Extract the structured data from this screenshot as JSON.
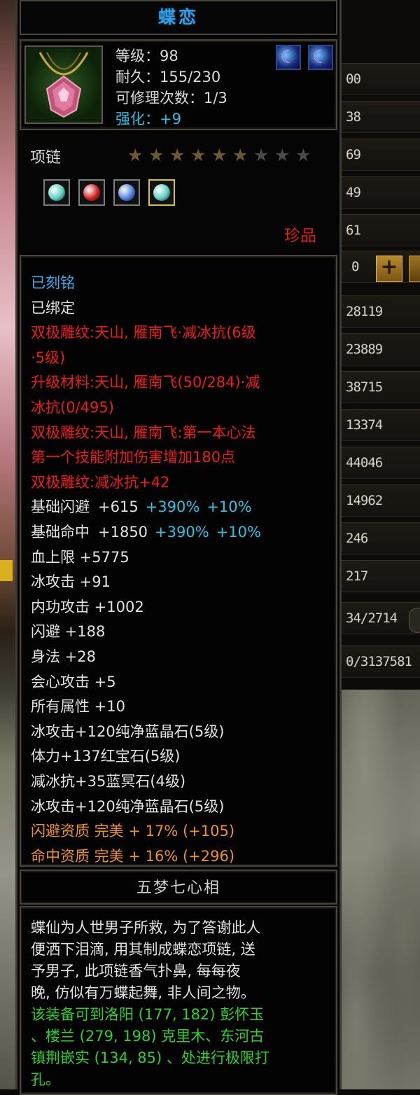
{
  "item": {
    "name": "蝶恋",
    "level": "等级：98",
    "durability": "耐久：155/230",
    "repair": "可修理次数：1/3",
    "enhance": "强化：+9",
    "type": "项链",
    "stars_total": 9,
    "stars_filled": 6,
    "rarity": "珍品"
  },
  "gems": [
    {
      "name": "cyan-gem",
      "color": "#5ad0c0"
    },
    {
      "name": "red-gem",
      "color": "#d22020"
    },
    {
      "name": "blue-gem",
      "color": "#5080e0"
    },
    {
      "name": "cyan-gem",
      "color": "#5ad0c0"
    }
  ],
  "attributes": [
    {
      "text": "已刻铭",
      "color": "blue"
    },
    {
      "text": "已绑定",
      "color": "white"
    },
    {
      "text": "双极雕纹:天山, 雁南飞·减冰抗(6级",
      "color": "red"
    },
    {
      "text": "·5级)",
      "color": "red"
    },
    {
      "text": "升级材料:天山, 雁南飞(50/284)·减",
      "color": "red"
    },
    {
      "text": "冰抗(0/495)",
      "color": "red"
    },
    {
      "text": "双极雕纹:天山, 雁南飞:第一本心法",
      "color": "red"
    },
    {
      "text": "第一个技能附加伤害增加180点",
      "color": "red"
    },
    {
      "text": "双极雕纹:减冰抗+42",
      "color": "red"
    }
  ],
  "base_stats": [
    {
      "label": "基础闪避",
      "value": "+615",
      "extra1": "+390%",
      "extra2": "+10%"
    },
    {
      "label": "基础命中",
      "value": "+1850",
      "extra1": "+390%",
      "extra2": "+10%"
    }
  ],
  "stats": [
    "血上限 +5775",
    "冰攻击 +91",
    "内功攻击 +1002",
    "闪避 +188",
    "身法 +28",
    "会心攻击 +5",
    "所有属性 +10"
  ],
  "gem_stats": [
    "冰攻击+120纯净蓝晶石(5级)",
    "体力+137红宝石(5级)",
    "减冰抗+35蓝冥石(4级)",
    "冰攻击+120纯净蓝晶石(5级)"
  ],
  "qualities": [
    "闪避资质 完美 + 17% (+105)",
    "命中资质 完美 + 16% (+296)"
  ],
  "set_name": "五梦七心相",
  "description": [
    "蝶仙为人世男子所救, 为了答谢此人",
    "便洒下泪滴, 用其制成蝶恋项链, 送",
    "予男子, 此项链香气扑鼻, 每每夜",
    "晚, 仿似有万蝶起舞, 非人间之物。"
  ],
  "location_hint": [
    "该装备可到洛阳 (177, 182) 彭怀玉",
    "、楼兰 (279, 198) 克里木、东河古",
    "镇荆嵌实 (134, 85) 、处进行极限打",
    "孔。"
  ],
  "background_values": [
    "00",
    "38",
    "69",
    "49",
    "61",
    "0",
    "28119",
    "23889",
    "38715",
    "13374",
    "44046",
    "14962",
    "246",
    "217",
    "34/2714",
    "0/3137581"
  ],
  "plus_label": "+"
}
